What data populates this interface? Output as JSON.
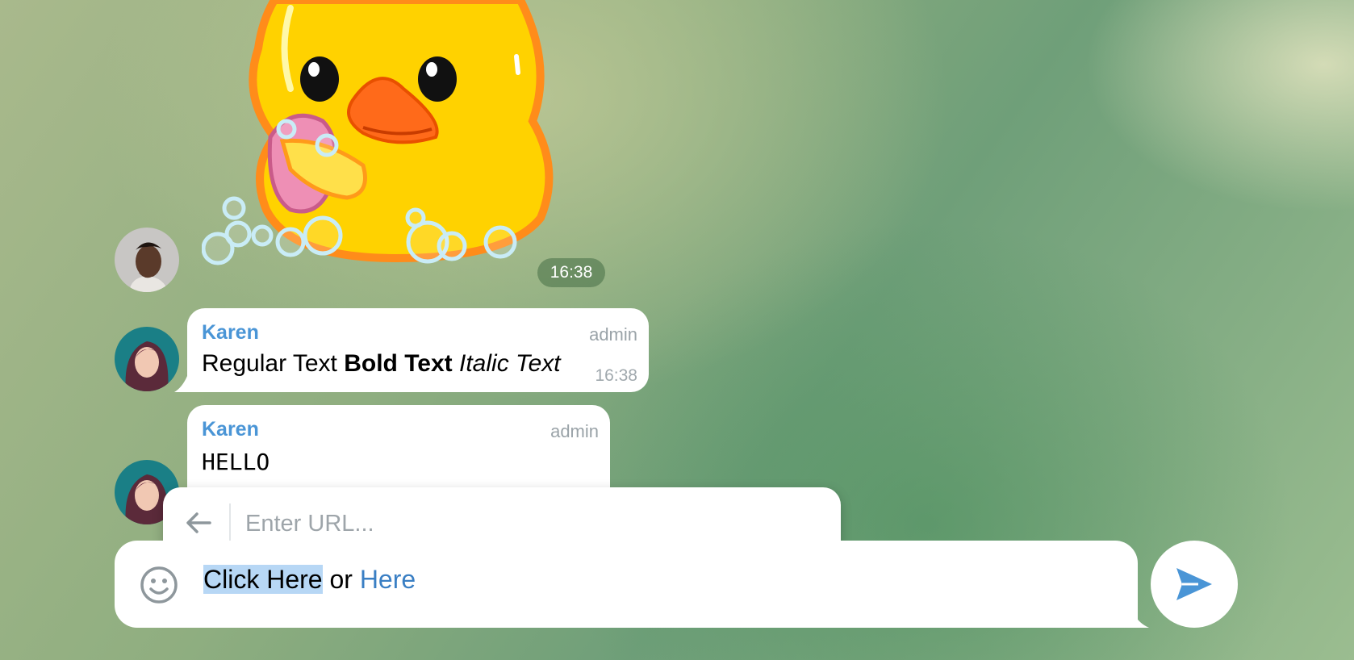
{
  "sticker": {
    "time": "16:38"
  },
  "messages": [
    {
      "sender": "Karen",
      "role": "admin",
      "segments": {
        "regular": "Regular Text",
        "bold": "Bold Text",
        "italic": "Italic Text"
      },
      "time": "16:38"
    },
    {
      "sender": "Karen",
      "role": "admin",
      "text": "HELLO"
    }
  ],
  "url_popup": {
    "placeholder": "Enter URL..."
  },
  "composer": {
    "selected_text": "Click Here",
    "middle_text": " or ",
    "link_text": "Here"
  },
  "colors": {
    "accent": "#4a95d6",
    "selection": "#b7d7f5"
  },
  "icons": {
    "back": "arrow-left-icon",
    "emoji": "smiley-icon",
    "send": "paper-plane-icon"
  }
}
